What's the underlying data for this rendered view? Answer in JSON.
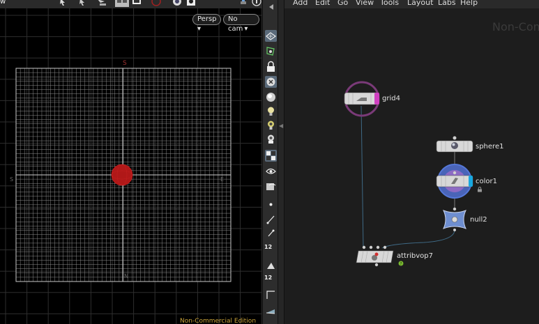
{
  "viewport": {
    "pane_label": "w",
    "persp_label": "Persp ▾",
    "cam_label": "No cam ▾",
    "axis_top": "S",
    "axis_left": "S",
    "axis_right": "E",
    "axis_bottom": "N",
    "watermark": "Non-Commercial Edition"
  },
  "side_toolbar": {
    "badge_12_a": "12",
    "badge_12_b": "12"
  },
  "menu": {
    "items": [
      "Add",
      "Edit",
      "Go",
      "View",
      "Tools",
      "Layout",
      "Labs",
      "Help"
    ]
  },
  "network": {
    "watermark": "Non-Com",
    "nodes": [
      {
        "label": "grid4"
      },
      {
        "label": "sphere1"
      },
      {
        "label": "color1"
      },
      {
        "label": "null2"
      },
      {
        "label": "attribvop7"
      }
    ]
  },
  "colors": {
    "grid_line": "#9a9a9a",
    "node_body": "#d8d8d8",
    "grid_ring": "#7a3a78",
    "grid_flag": "#d040c0",
    "color_ring": "#5578d8",
    "color_flag": "#18a8e0",
    "null_shape": "#6e8ed0",
    "red_ball": "#b01818",
    "watermark": "#c9a33a"
  }
}
